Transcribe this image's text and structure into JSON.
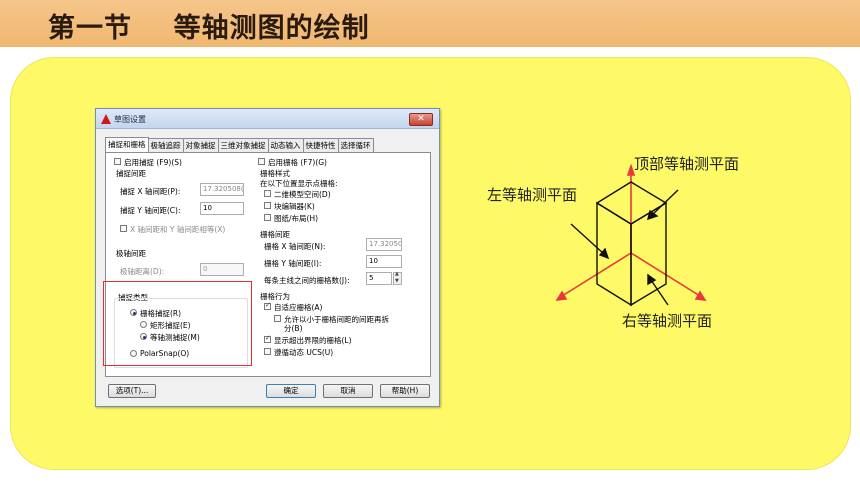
{
  "slide": {
    "title": "第一节    等轴测图的绘制"
  },
  "dialog": {
    "title": "草图设置",
    "close_icon": "close-x-icon",
    "tabs": [
      {
        "label": "捕捉和栅格",
        "active": true
      },
      {
        "label": "极轴追踪",
        "active": false
      },
      {
        "label": "对象捕捉",
        "active": false
      },
      {
        "label": "三维对象捕捉",
        "active": false
      },
      {
        "label": "动态输入",
        "active": false
      },
      {
        "label": "快捷特性",
        "active": false
      },
      {
        "label": "选择循环",
        "active": false
      }
    ],
    "snap": {
      "enable_label": "启用捕捉 (F9)(S)",
      "enable_checked": false,
      "spacing_title": "捕捉间距",
      "x_label": "捕捉 X 轴间距(P):",
      "x_value": "17.320508(",
      "y_label": "捕捉 Y 轴间距(C):",
      "y_value": "10",
      "equal_label": "X 轴间距和 Y 轴间距相等(X)",
      "equal_checked": false
    },
    "polar": {
      "title": "极轴间距",
      "distance_label": "极轴距离(D):",
      "distance_value": "0"
    },
    "snap_type": {
      "title": "捕捉类型",
      "grid_snap_label": "栅格捕捉(R)",
      "grid_snap_selected": true,
      "rect_snap_label": "矩形捕捉(E)",
      "rect_snap_selected": false,
      "iso_snap_label": "等轴测捕捉(M)",
      "iso_snap_selected": true,
      "polar_snap_label": "PolarSnap(O)",
      "polar_snap_selected": false
    },
    "grid": {
      "enable_label": "启用栅格 (F7)(G)",
      "enable_checked": false,
      "style_title": "栅格样式",
      "style_sub": "在以下位置显示点栅格:",
      "model_label": "二维模型空间(D)",
      "block_label": "块编辑器(K)",
      "layout_label": "图纸/布局(H)",
      "spacing_title": "栅格间距",
      "x_label": "栅格 X 轴间距(N):",
      "x_value": "17.32050(",
      "y_label": "栅格 Y 轴间距(I):",
      "y_value": "10",
      "major_label": "每条主线之间的栅格数(J):",
      "major_value": "5",
      "behavior_title": "栅格行为",
      "adaptive_label": "自适应栅格(A)",
      "adaptive_checked": true,
      "subdivide_label_1": "允许以小于栅格间距的间距再拆",
      "subdivide_label_2": "分(B)",
      "subdivide_checked": false,
      "beyond_label": "显示超出界限的栅格(L)",
      "beyond_checked": true,
      "follow_ucs_label": "遵循动态 UCS(U)",
      "follow_ucs_checked": false
    },
    "buttons": {
      "options": "选项(T)...",
      "ok": "确定",
      "cancel": "取消",
      "help": "帮助(H)"
    }
  },
  "diagram": {
    "top_label": "顶部等轴测平面",
    "left_label": "左等轴测平面",
    "right_label": "右等轴测平面",
    "axis_color": "#e8383c",
    "cube_color": "#111111"
  },
  "colors": {
    "header_bg": "#f2bd7a",
    "panel_bg": "#fef966",
    "highlight": "#e03030"
  }
}
